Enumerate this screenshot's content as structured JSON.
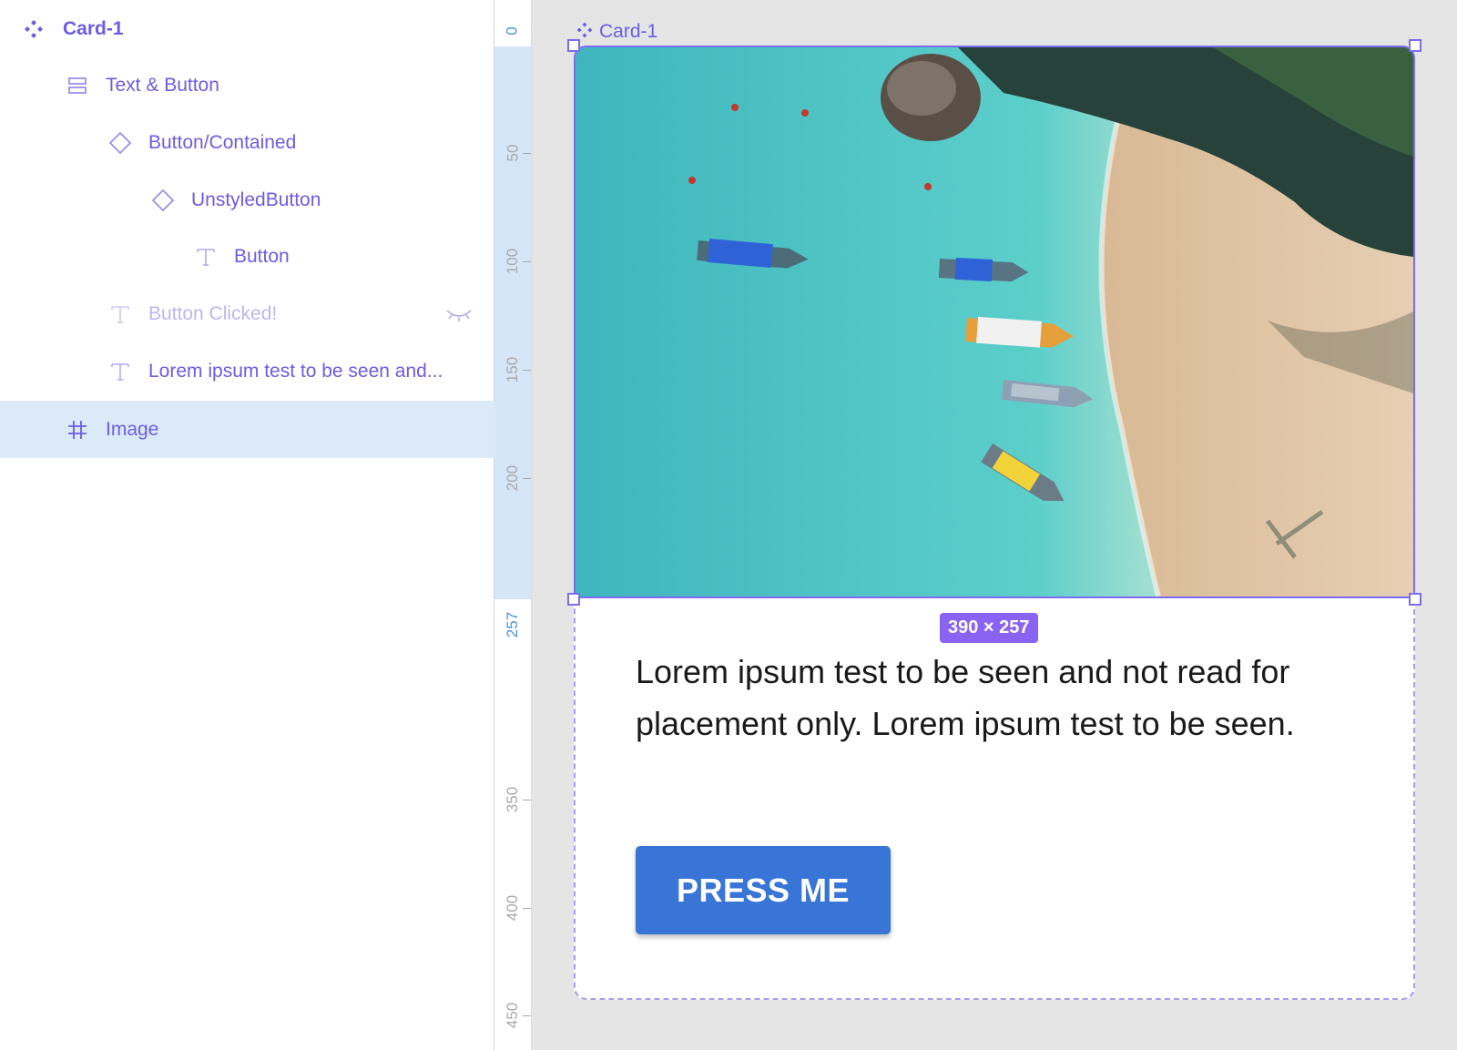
{
  "layers": {
    "items": [
      {
        "label": "Card-1",
        "icon": "component-icon"
      },
      {
        "label": "Text & Button",
        "icon": "auto-layout-icon"
      },
      {
        "label": "Button/Contained",
        "icon": "instance-icon"
      },
      {
        "label": "UnstyledButton",
        "icon": "instance-icon"
      },
      {
        "label": "Button",
        "icon": "text-icon"
      },
      {
        "label": "Button Clicked!",
        "icon": "text-icon",
        "hidden": true
      },
      {
        "label": "Lorem ipsum test to be seen and...",
        "icon": "text-icon"
      },
      {
        "label": "Image",
        "icon": "frame-icon",
        "selected": true
      }
    ]
  },
  "ruler": {
    "marks": [
      "0",
      "50",
      "100",
      "150",
      "200",
      "257",
      "350",
      "400",
      "450"
    ]
  },
  "canvas": {
    "frame_label": "Card-1",
    "size_badge": "390 × 257",
    "card_text": "Lorem ipsum test to be seen and not read for placement only. Lorem ipsum test to be seen.",
    "button_label": "PRESS ME"
  },
  "colors": {
    "accent": "#6b5ce6",
    "selection": "#7b6cf0",
    "badge": "#8a63f2",
    "button": "#3875d7",
    "ruler_highlight": "#d5e6f8"
  }
}
